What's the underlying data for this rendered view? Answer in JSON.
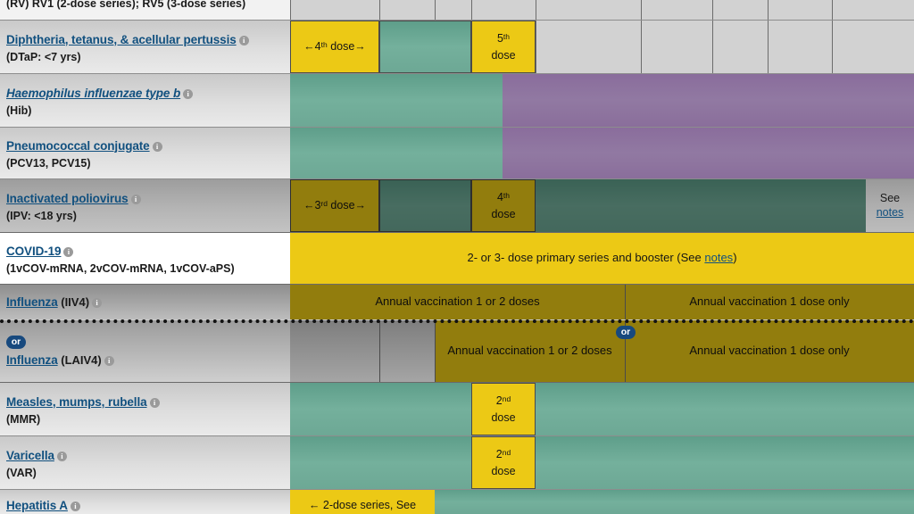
{
  "title": "Recommended Child and Adolescent Immunization Schedule",
  "colors": {
    "yellow": "#ecc915",
    "green": "#6da895",
    "purple": "#8a6e9b",
    "link": "#11507f",
    "or_badge": "#17497e"
  },
  "info_icon_glyph": "i",
  "partial_row_top": {
    "label": "(RV) RV1 (2-dose series); RV5 (3-dose series)"
  },
  "rows": [
    {
      "id": "dtap",
      "name": "Diphtheria, tetanus, & acellular pertussis",
      "sub": "(DTaP: <7 yrs)",
      "cells": [
        {
          "text": "←4th dose→",
          "sup": "th",
          "color": "yellow"
        },
        {
          "text": "",
          "color": "green"
        },
        {
          "text": "5th dose",
          "sup": "th",
          "color": "yellow"
        }
      ]
    },
    {
      "id": "hib",
      "name": "Haemophilus influenzae type b",
      "sub": "(Hib)",
      "cells": [
        {
          "text": "",
          "color": "green"
        },
        {
          "text": "",
          "color": "purple"
        }
      ]
    },
    {
      "id": "pcv",
      "name": "Pneumococcal conjugate",
      "sub": "(PCV13, PCV15)",
      "cells": [
        {
          "text": "",
          "color": "green"
        },
        {
          "text": "",
          "color": "purple"
        }
      ]
    },
    {
      "id": "ipv",
      "name": "Inactivated poliovirus",
      "sub": "(IPV: <18 yrs)",
      "cells": [
        {
          "text": "←3rd dose→",
          "sup": "rd",
          "color": "yellow"
        },
        {
          "text": "",
          "color": "green"
        },
        {
          "text": "4th dose",
          "sup": "th",
          "color": "yellow"
        },
        {
          "text": "",
          "color": "green"
        },
        {
          "text": "See notes",
          "color": "gray",
          "link": "notes"
        }
      ]
    },
    {
      "id": "covid19",
      "name": "COVID-19",
      "sub": "(1vCOV-mRNA, 2vCOV-mRNA, 1vCOV-aPS)",
      "cells": [
        {
          "text": "2- or 3- dose primary series and booster (See notes)",
          "color": "yellow",
          "link": "notes"
        }
      ]
    },
    {
      "id": "influenza-iiv4",
      "name": "Influenza",
      "name_suffix": "(IIV4)",
      "sub": "",
      "cells": [
        {
          "text": "Annual vaccination 1 or 2 doses",
          "color": "yellow-dim"
        },
        {
          "text": "Annual vaccination 1 dose only",
          "color": "yellow-dim"
        }
      ]
    },
    {
      "id": "influenza-laiv4",
      "name": "Influenza",
      "name_suffix": "(LAIV4)",
      "sub": "",
      "or_badge": "or",
      "cells": [
        {
          "text": "Annual vaccination 1 or 2 doses",
          "color": "yellow-dim"
        },
        {
          "text": "Annual vaccination 1 dose only",
          "color": "yellow-dim"
        }
      ]
    },
    {
      "id": "mmr",
      "name": "Measles, mumps, rubella",
      "sub": "(MMR)",
      "cells": [
        {
          "text": "",
          "color": "green"
        },
        {
          "text": "2nd dose",
          "sup": "nd",
          "color": "yellow"
        },
        {
          "text": "",
          "color": "green"
        }
      ]
    },
    {
      "id": "var",
      "name": "Varicella",
      "sub": "(VAR)",
      "cells": [
        {
          "text": "",
          "color": "green"
        },
        {
          "text": "2nd dose",
          "sup": "nd",
          "color": "yellow"
        },
        {
          "text": "",
          "color": "green"
        }
      ]
    },
    {
      "id": "hepa",
      "name": "Hepatitis A",
      "sub": "",
      "cells": [
        {
          "text": "← 2-dose series, See",
          "color": "yellow"
        },
        {
          "text": "",
          "color": "green"
        }
      ]
    }
  ],
  "labels": {
    "dtap_dose4": "←4",
    "dtap_dose4_sup": "th",
    "dtap_dose4_end": " dose→",
    "dtap_dose5": "5",
    "dtap_dose5_sup": "th",
    "dtap_dose5_end": "dose",
    "ipv_dose3": "←3",
    "ipv_dose3_sup": "rd",
    "ipv_dose3_end": " dose→",
    "ipv_dose4": "4",
    "ipv_dose4_sup": "th",
    "ipv_dose4_end": "dose",
    "see": "See",
    "notes": "notes",
    "covid_text_pre": "2- or 3- dose primary series and booster (See ",
    "covid_text_post": ")",
    "flu_1or2": "Annual vaccination 1 or 2 doses",
    "flu_1only": "Annual vaccination 1 dose only",
    "flu_1or2_laiv": "Annual vaccination 1 or 2 doses",
    "flu_1only_laiv": "Annual vaccination 1 dose only",
    "dose2": "2",
    "dose2_sup": "nd",
    "dose2_end": "dose",
    "hepa_text": "← 2-dose series, See",
    "or": "or"
  }
}
